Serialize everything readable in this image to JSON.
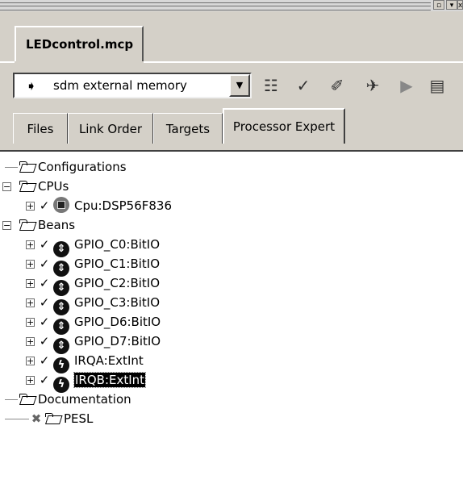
{
  "document_tab": {
    "label": "LEDcontrol.mcp"
  },
  "toolbar": {
    "target_select": {
      "value": "sdm external memory",
      "icon": "target-icon"
    },
    "buttons": [
      {
        "name": "settings-button",
        "icon": "settings-icon",
        "glyph": "☷"
      },
      {
        "name": "synchronize-button",
        "icon": "check-icon",
        "glyph": "✓"
      },
      {
        "name": "make-button",
        "icon": "make-icon",
        "glyph": "✐"
      },
      {
        "name": "debug-button",
        "icon": "debug-icon",
        "glyph": "✈"
      },
      {
        "name": "run-button",
        "icon": "run-icon",
        "glyph": "▶"
      },
      {
        "name": "project-inspector-button",
        "icon": "inspector-icon",
        "glyph": "▤"
      }
    ]
  },
  "subtabs": [
    "Files",
    "Link Order",
    "Targets",
    "Processor Expert"
  ],
  "tree": {
    "configurations": "Configurations",
    "cpus": "CPUs",
    "cpu_item": "Cpu:DSP56F836",
    "beans": "Beans",
    "bean_items": [
      "GPIO_C0:BitIO",
      "GPIO_C1:BitIO",
      "GPIO_C2:BitIO",
      "GPIO_C3:BitIO",
      "GPIO_D6:BitIO",
      "GPIO_D7:BitIO",
      "IRQA:ExtInt",
      "IRQB:ExtInt"
    ],
    "documentation": "Documentation",
    "pesl": "PESL"
  }
}
